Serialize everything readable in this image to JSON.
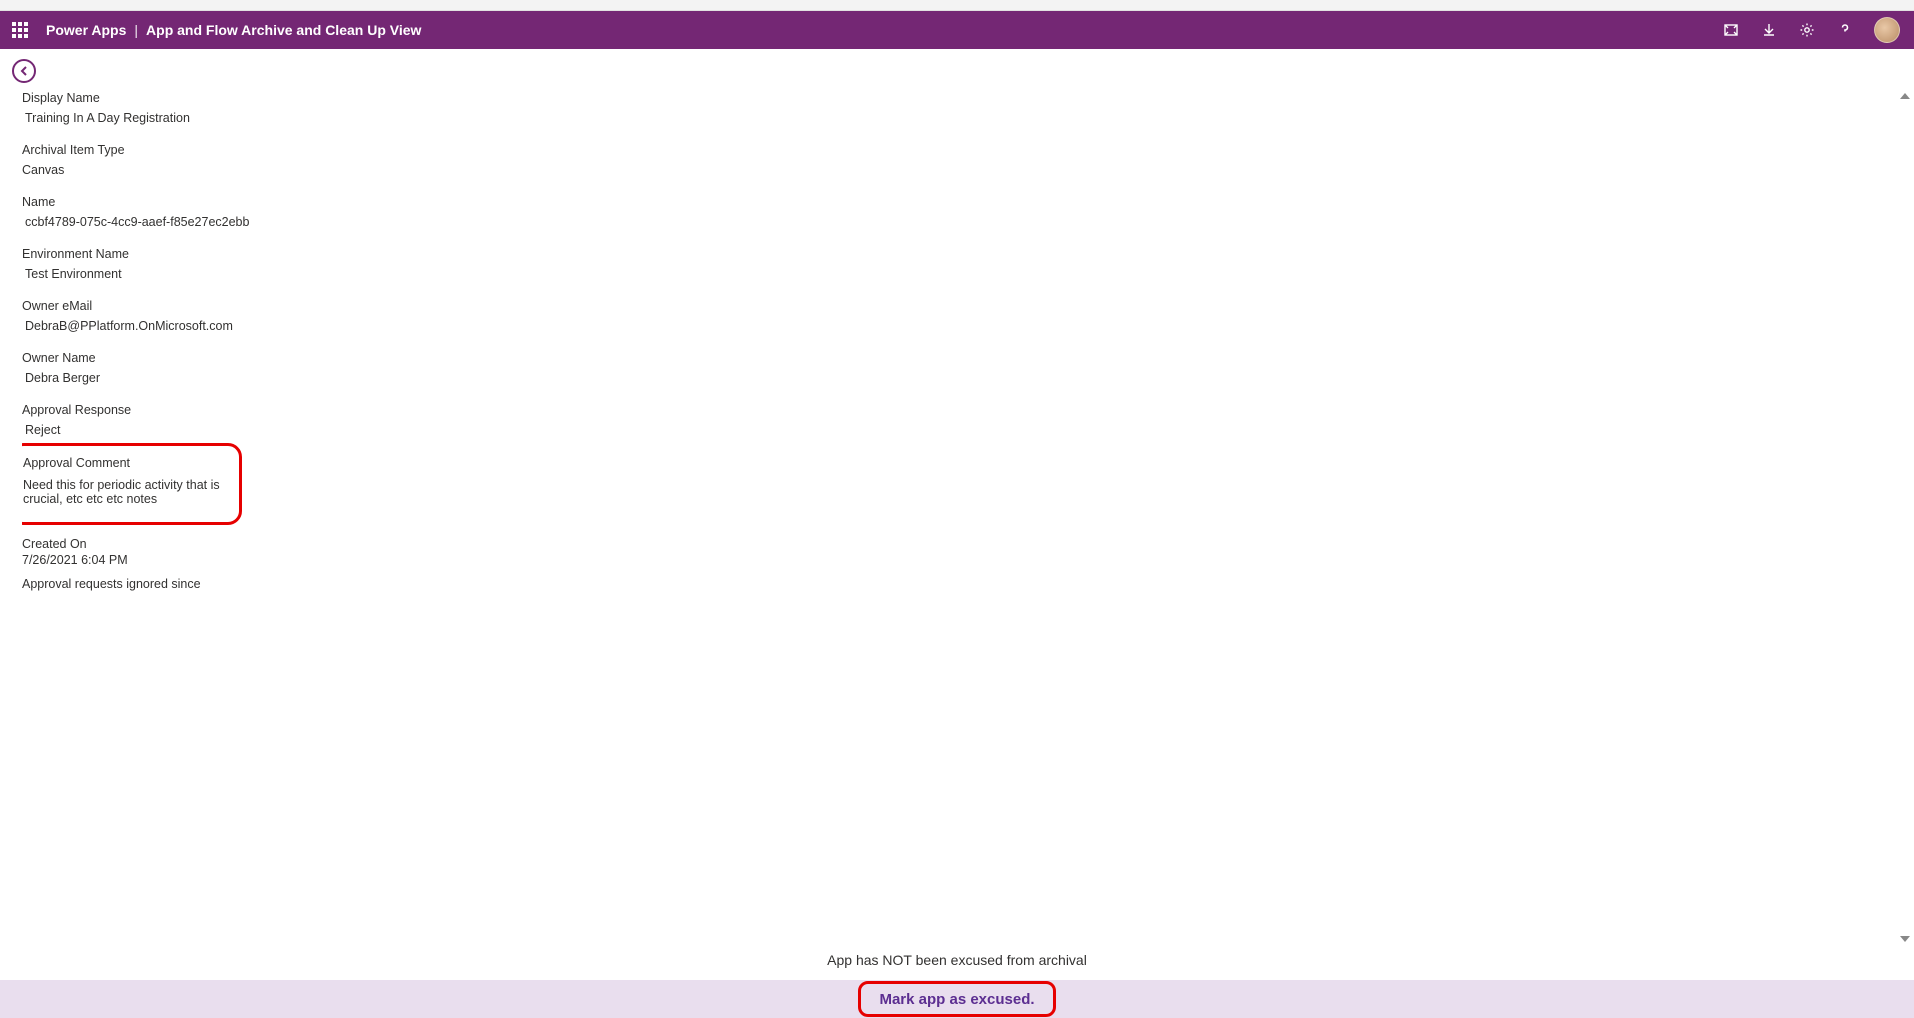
{
  "header": {
    "product": "Power Apps",
    "page_title": "App and Flow Archive and Clean Up View"
  },
  "fields": {
    "display_name": {
      "label": "Display Name",
      "value": "Training In A Day Registration"
    },
    "archival_item_type": {
      "label": "Archival Item Type",
      "value": "Canvas"
    },
    "name": {
      "label": "Name",
      "value": "ccbf4789-075c-4cc9-aaef-f85e27ec2ebb"
    },
    "environment_name": {
      "label": "Environment Name",
      "value": "Test Environment"
    },
    "owner_email": {
      "label": "Owner eMail",
      "value": "DebraB@PPlatform.OnMicrosoft.com"
    },
    "owner_name": {
      "label": "Owner Name",
      "value": "Debra Berger"
    },
    "approval_response": {
      "label": "Approval Response",
      "value": "Reject"
    },
    "approval_comment": {
      "label": "Approval Comment",
      "value": "Need this for periodic activity that is crucial, etc etc etc notes"
    },
    "created_on": {
      "label": "Created On",
      "value": "7/26/2021 6:04 PM"
    },
    "ignored_since": {
      "label": "Approval requests ignored since",
      "value": ""
    }
  },
  "status_message": "App has NOT been excused from archival",
  "action_button": "Mark app as excused."
}
